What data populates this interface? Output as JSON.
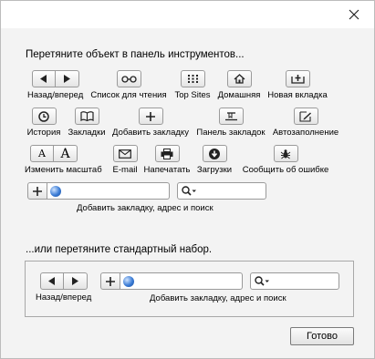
{
  "heading_drag_items": "Перетяните объект в панель инструментов...",
  "heading_drag_default": "...или перетяните стандартный набор.",
  "items": {
    "back_forward": "Назад/вперед",
    "reading_list": "Список для чтения",
    "top_sites": "Top Sites",
    "home": "Домашняя",
    "new_tab": "Новая вкладка",
    "history": "История",
    "bookmarks": "Закладки",
    "add_bookmark": "Добавить закладку",
    "bookmarks_bar": "Панель закладок",
    "autofill": "Автозаполнение",
    "zoom": "Изменить масштаб",
    "email": "E-mail",
    "print": "Напечатать",
    "downloads": "Загрузки",
    "report_bug": "Сообщить об ошибке",
    "address_search": "Добавить закладку, адрес и поиск"
  },
  "zoom_letters": {
    "small": "A",
    "large": "A"
  },
  "default_set": {
    "back_forward": "Назад/вперед",
    "address_search": "Добавить закладку, адрес и поиск"
  },
  "buttons": {
    "done": "Готово"
  },
  "icons": [
    "close-icon",
    "back-arrow-icon",
    "forward-arrow-icon",
    "glasses-icon",
    "grid-icon",
    "house-icon",
    "new-tab-icon",
    "clock-icon",
    "book-icon",
    "plus-icon",
    "bookmarks-bar-icon",
    "pencil-icon",
    "envelope-icon",
    "printer-icon",
    "download-icon",
    "bug-icon",
    "globe-icon",
    "search-icon"
  ]
}
